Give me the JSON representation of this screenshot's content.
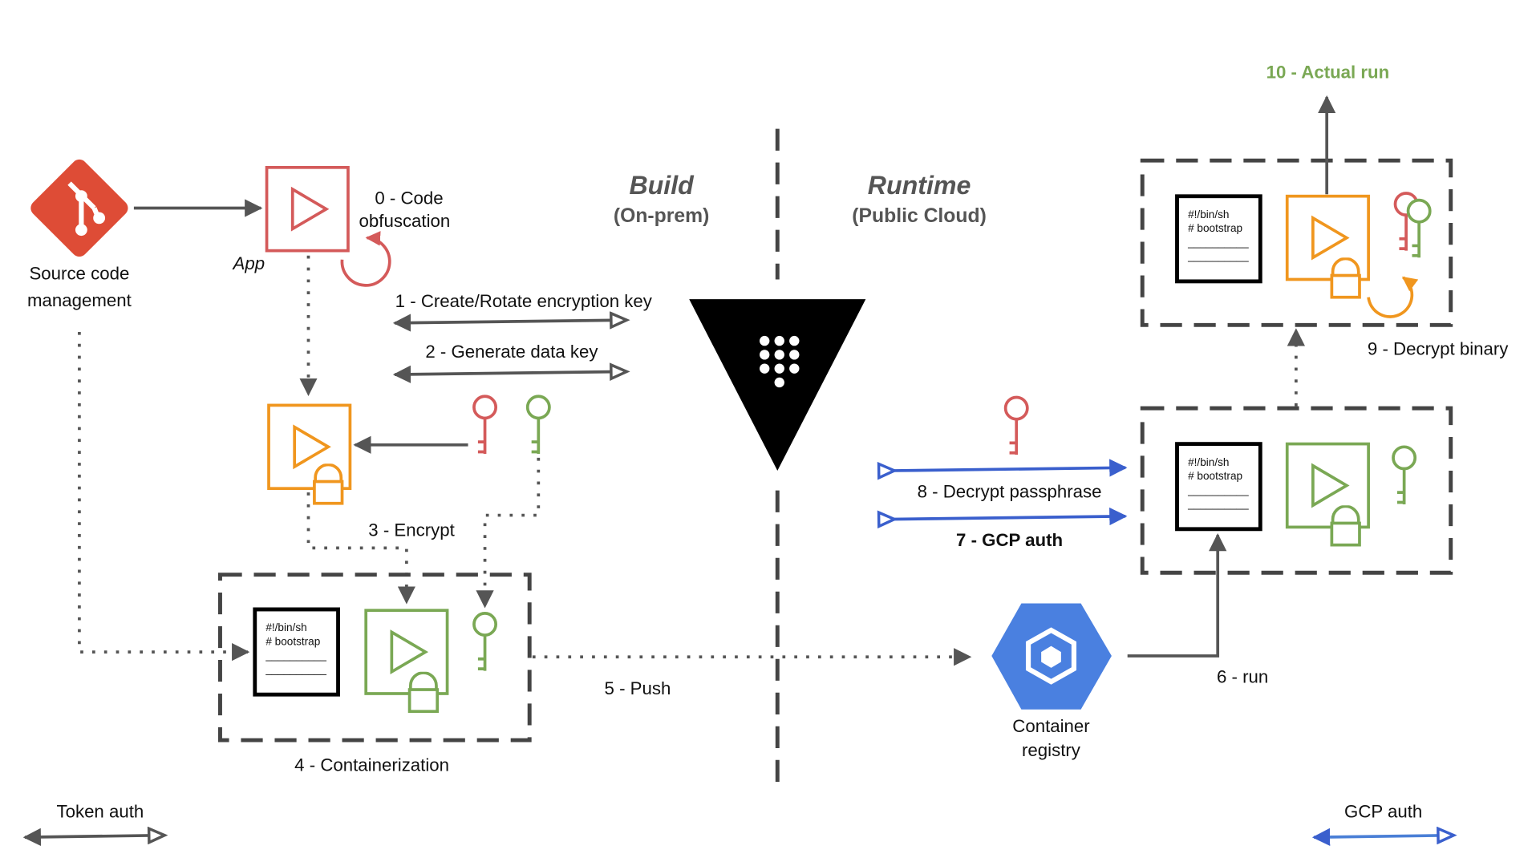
{
  "colors": {
    "red": "#d45a5a",
    "orange": "#f0961e",
    "green": "#7aa854",
    "blue": "#3a5fcd",
    "git": "#de4c36",
    "registry": "#4a80e0",
    "gray": "#555555"
  },
  "icons": [
    "git-icon",
    "app-binary-icon",
    "rotate-icon",
    "vault-icon",
    "key-icon",
    "lock-icon",
    "container-registry-icon",
    "script-icon"
  ],
  "source": {
    "line1": "Source code",
    "line2": "management"
  },
  "app_label": "App",
  "step0": {
    "line1": "0 - Code",
    "line2": "obfuscation"
  },
  "build": {
    "title": "Build",
    "subtitle": "(On-prem)"
  },
  "runtime": {
    "title": "Runtime",
    "subtitle": "(Public Cloud)"
  },
  "step1": "1 - Create/Rotate encryption key",
  "step2": "2 - Generate data key",
  "step3": "3 - Encrypt",
  "step4": "4 - Containerization",
  "step5": "5 - Push",
  "step6": "6 - run",
  "step7": "7 - GCP auth",
  "step8": "8 - Decrypt passphrase",
  "step9": "9 - Decrypt binary",
  "step10": "10 - Actual run",
  "registry": {
    "line1": "Container",
    "line2": "registry"
  },
  "script": {
    "line1": "#!/bin/sh",
    "line2": "# bootstrap",
    "line3": "__________",
    "line4": "__________"
  },
  "legend": {
    "token": "Token auth",
    "gcp": "GCP auth"
  }
}
